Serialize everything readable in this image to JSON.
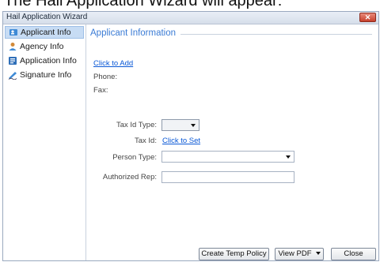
{
  "caption": "The Hail Application Wizard will appear:",
  "window": {
    "title": "Hail Application Wizard",
    "close_label": "✕"
  },
  "sidebar": {
    "items": [
      {
        "label": "Applicant Info",
        "active": true
      },
      {
        "label": "Agency Info",
        "active": false
      },
      {
        "label": "Application Info",
        "active": false
      },
      {
        "label": "Signature Info",
        "active": false
      }
    ]
  },
  "main": {
    "section_title": "Applicant Information",
    "click_to_add": "Click to Add",
    "phone_label": "Phone:",
    "fax_label": "Fax:",
    "tax_id_type_label": "Tax Id Type:",
    "tax_id_label": "Tax Id:",
    "click_to_set": "Click to Set",
    "person_type_label": "Person Type:",
    "authorized_rep_label": "Authorized Rep:"
  },
  "buttons": {
    "create_temp_policy": "Create Temp Policy",
    "view_pdf": "View PDF",
    "close": "Close"
  },
  "colors": {
    "accent": "#3a7bd5",
    "link": "#0a58d6",
    "active_nav": "#c7dcf4"
  }
}
